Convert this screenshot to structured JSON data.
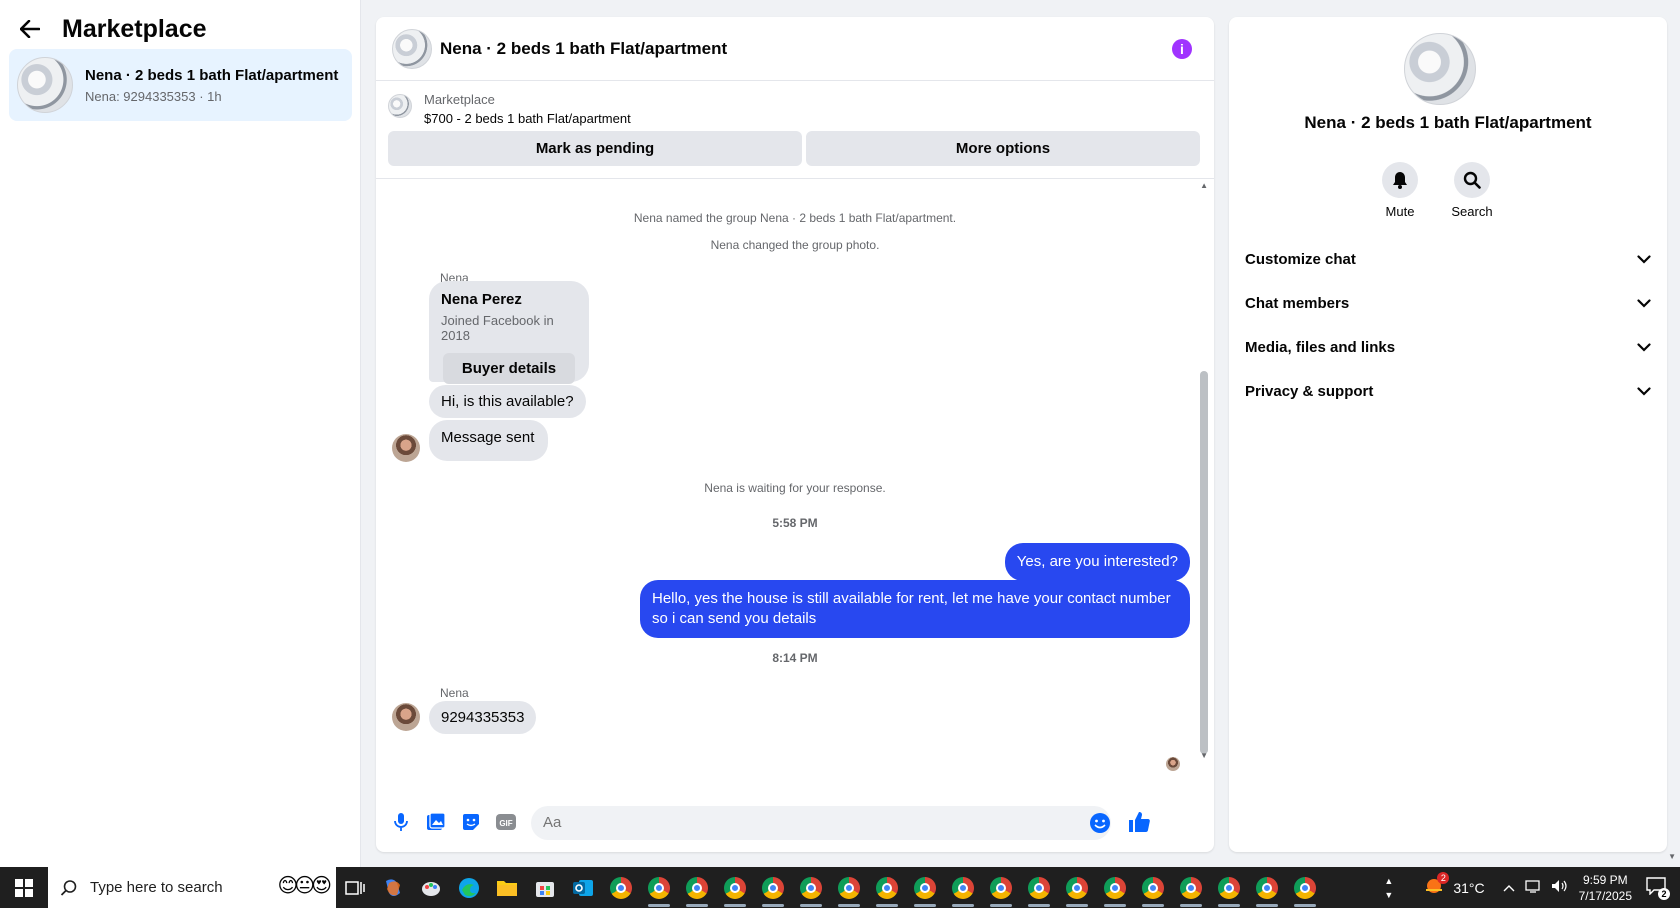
{
  "sidebar": {
    "title": "Marketplace",
    "conversation": {
      "title": "Nena · 2 beds 1 bath Flat/apartment",
      "subtitle": "Nena: 9294335353 · 1h"
    }
  },
  "chat": {
    "header_title": "Nena · 2 beds 1 bath Flat/apartment",
    "listing": {
      "label": "Marketplace",
      "price_title": "$700 - 2 beds 1 bath Flat/apartment",
      "mark_pending": "Mark as pending",
      "more_options": "More options"
    },
    "messages": {
      "sys1": "Nena named the group Nena · 2 beds 1 bath Flat/apartment.",
      "sys2": "Nena changed the group photo.",
      "sender1": "Nena",
      "card_name": "Nena Perez",
      "card_sub": "Joined Facebook in 2018",
      "card_button": "Buyer details",
      "msg1": "Hi, is this available?",
      "msg2": "Message sent",
      "sys3": "Nena is waiting for your response.",
      "time1": "5:58 PM",
      "out1": "Yes, are you interested?",
      "out2": "Hello, yes the house is still available for rent, let me have your contact number so i can send you details",
      "time2": "8:14 PM",
      "sender2": "Nena",
      "msg3": "9294335353"
    },
    "composer": {
      "placeholder": "Aa"
    }
  },
  "details": {
    "title": "Nena · 2 beds 1 bath Flat/apartment",
    "mute_label": "Mute",
    "search_label": "Search",
    "sections": [
      "Customize chat",
      "Chat members",
      "Media, files and links",
      "Privacy & support"
    ]
  },
  "taskbar": {
    "search_placeholder": "Type here to search",
    "emojis": "😊😐😍",
    "weather": "31°C",
    "weather_badge": "2",
    "time": "9:59 PM",
    "date": "7/17/2025",
    "notification_count": "2"
  },
  "colors": {
    "outgoing_bubble": "#2848f0",
    "accent_blue": "#0866ff",
    "info_purple": "#a033ff",
    "selected_conversation": "#e7f3ff"
  }
}
